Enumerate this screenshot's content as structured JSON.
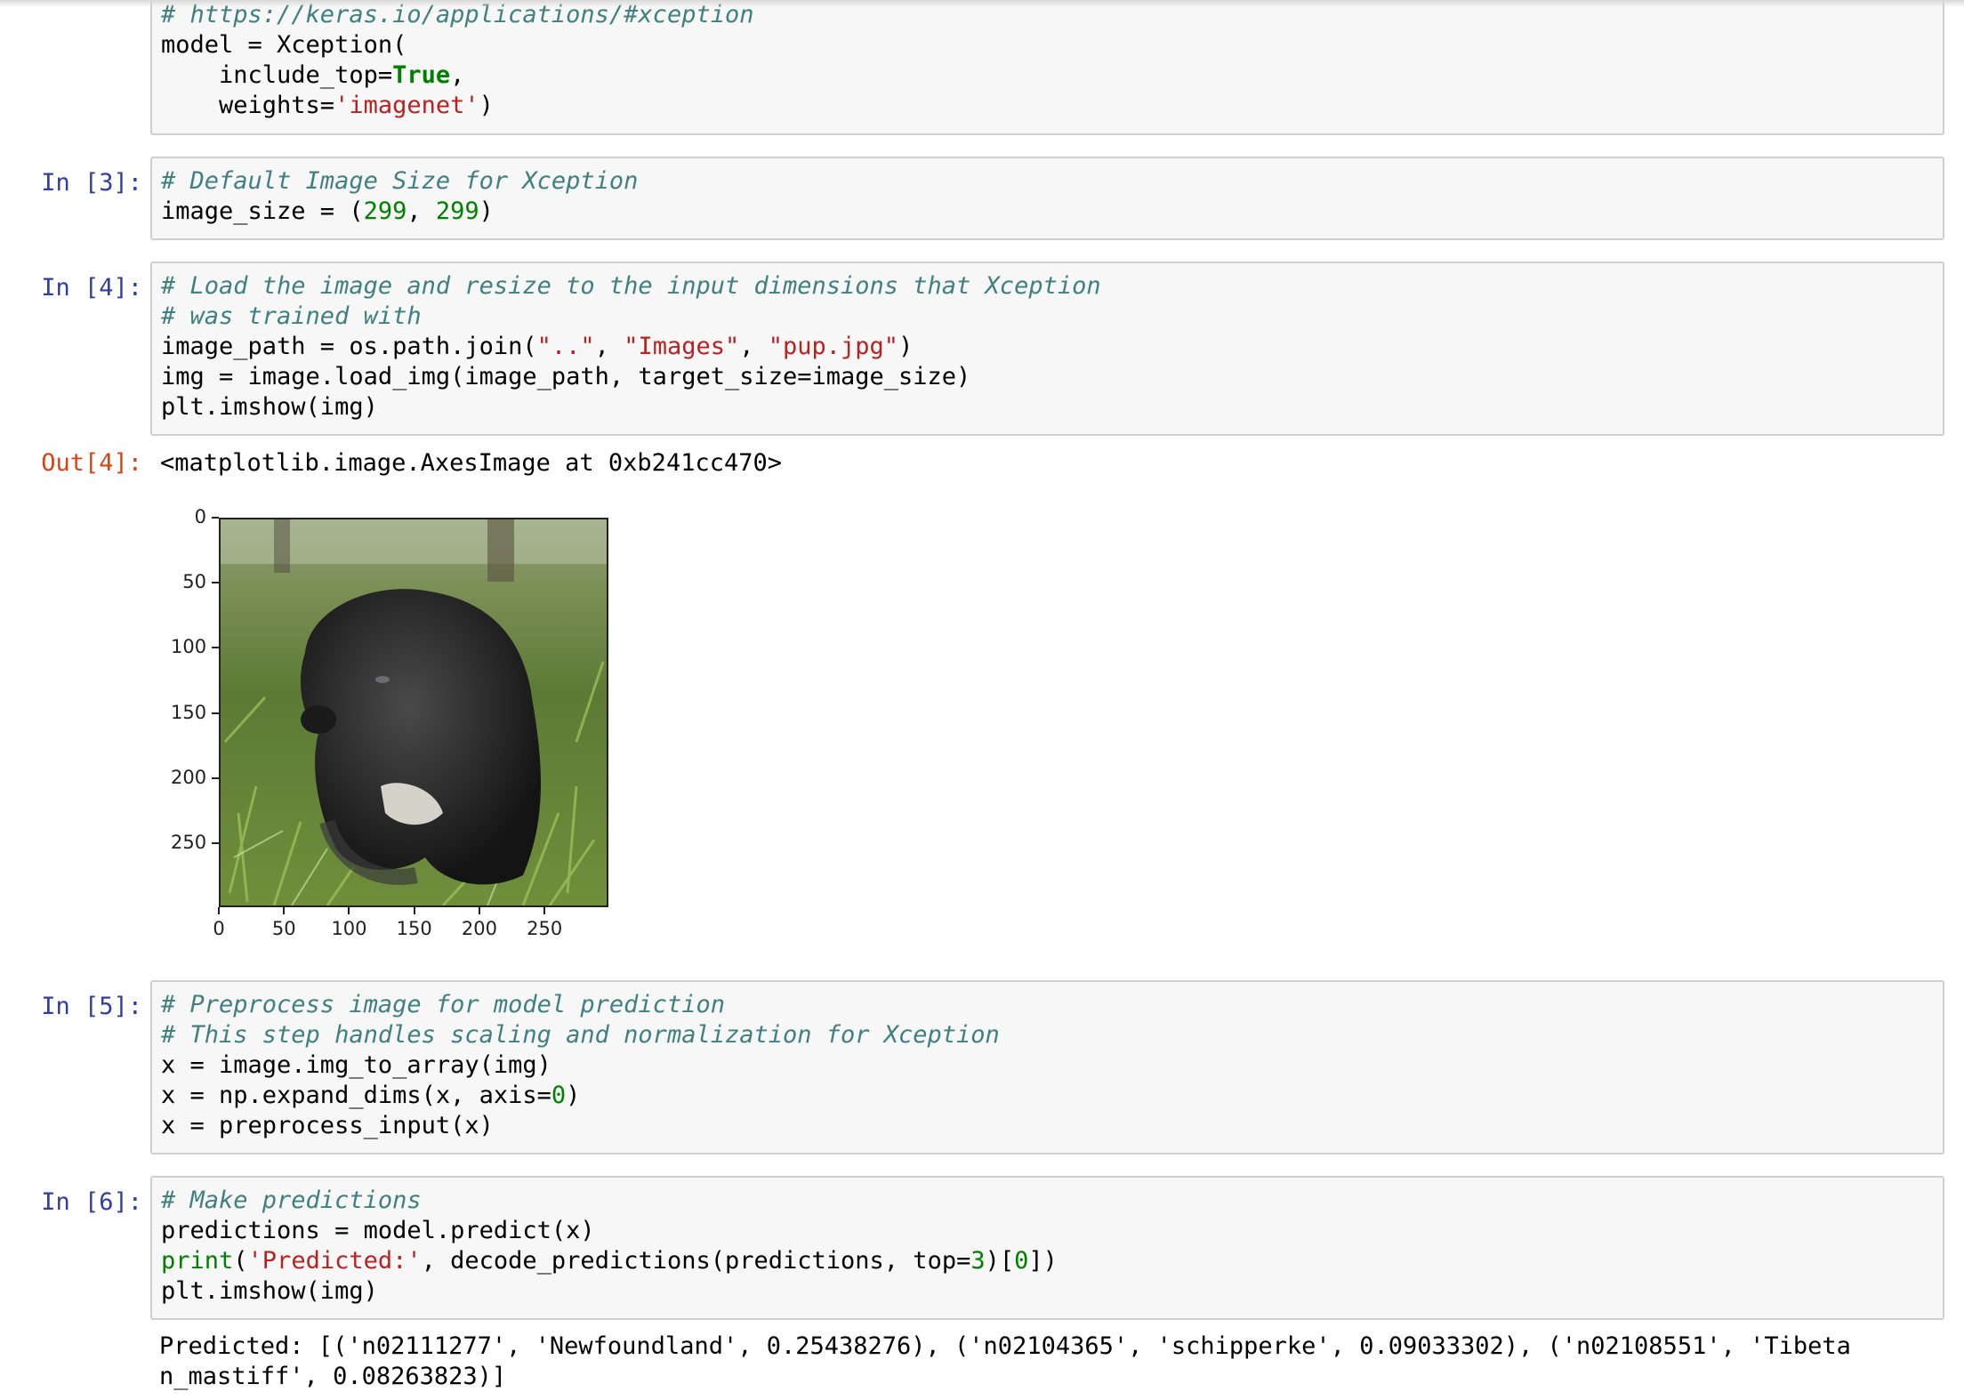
{
  "cells": {
    "top": {
      "lines": [
        [
          {
            "t": "# https://keras.io/applications/#xception",
            "c": "comment"
          }
        ],
        [
          {
            "t": "model = Xception(",
            "c": ""
          }
        ],
        [
          {
            "t": "    include_top=",
            "c": ""
          },
          {
            "t": "True",
            "c": "kw"
          },
          {
            "t": ",",
            "c": ""
          }
        ],
        [
          {
            "t": "    weights=",
            "c": ""
          },
          {
            "t": "'imagenet'",
            "c": "str"
          },
          {
            "t": ")",
            "c": ""
          }
        ]
      ]
    },
    "cell3": {
      "prompt": "In [3]:",
      "lines": [
        [
          {
            "t": "# Default Image Size for Xception",
            "c": "comment"
          }
        ],
        [
          {
            "t": "image_size = (",
            "c": ""
          },
          {
            "t": "299",
            "c": "num"
          },
          {
            "t": ", ",
            "c": ""
          },
          {
            "t": "299",
            "c": "num"
          },
          {
            "t": ")",
            "c": ""
          }
        ]
      ]
    },
    "cell4": {
      "prompt": "In [4]:",
      "lines": [
        [
          {
            "t": "# Load the image and resize to the input dimensions that Xception",
            "c": "comment"
          }
        ],
        [
          {
            "t": "# was trained with",
            "c": "comment"
          }
        ],
        [
          {
            "t": "image_path = os.path.join(",
            "c": ""
          },
          {
            "t": "\"..\"",
            "c": "str"
          },
          {
            "t": ", ",
            "c": ""
          },
          {
            "t": "\"Images\"",
            "c": "str"
          },
          {
            "t": ", ",
            "c": ""
          },
          {
            "t": "\"pup.jpg\"",
            "c": "str"
          },
          {
            "t": ")",
            "c": ""
          }
        ],
        [
          {
            "t": "img = image.load_img(image_path, target_size=image_size)",
            "c": ""
          }
        ],
        [
          {
            "t": "plt.imshow(img)",
            "c": ""
          }
        ]
      ],
      "out_prompt": "Out[4]:",
      "out_text": "<matplotlib.image.AxesImage at 0xb241cc470>"
    },
    "cell5": {
      "prompt": "In [5]:",
      "lines": [
        [
          {
            "t": "# Preprocess image for model prediction",
            "c": "comment"
          }
        ],
        [
          {
            "t": "# This step handles scaling and normalization for Xception",
            "c": "comment"
          }
        ],
        [
          {
            "t": "x = image.img_to_array(img)",
            "c": ""
          }
        ],
        [
          {
            "t": "x = np.expand_dims(x, axis=",
            "c": ""
          },
          {
            "t": "0",
            "c": "num"
          },
          {
            "t": ")",
            "c": ""
          }
        ],
        [
          {
            "t": "x = preprocess_input(x)",
            "c": ""
          }
        ]
      ]
    },
    "cell6": {
      "prompt": "In [6]:",
      "lines": [
        [
          {
            "t": "# Make predictions",
            "c": "comment"
          }
        ],
        [
          {
            "t": "predictions = model.predict(x)",
            "c": ""
          }
        ],
        [
          {
            "t": "print",
            "c": "builtin"
          },
          {
            "t": "(",
            "c": ""
          },
          {
            "t": "'Predicted:'",
            "c": "str"
          },
          {
            "t": ", decode_predictions(predictions, top=",
            "c": ""
          },
          {
            "t": "3",
            "c": "num"
          },
          {
            "t": ")[",
            "c": ""
          },
          {
            "t": "0",
            "c": "num"
          },
          {
            "t": "])",
            "c": ""
          }
        ],
        [
          {
            "t": "plt.imshow(img)",
            "c": ""
          }
        ]
      ],
      "out_line1": "Predicted: [('n02111277', 'Newfoundland', 0.25438276), ('n02104365', 'schipperke', 0.09033302), ('n02108551', 'Tibeta",
      "out_line2": "n_mastiff', 0.08263823)]"
    }
  },
  "plot": {
    "yticks": [
      "0",
      "50",
      "100",
      "150",
      "200",
      "250"
    ],
    "xticks": [
      "0",
      "50",
      "100",
      "150",
      "200",
      "250"
    ],
    "image_size": 299,
    "image_description_icon": "puppy-image"
  }
}
